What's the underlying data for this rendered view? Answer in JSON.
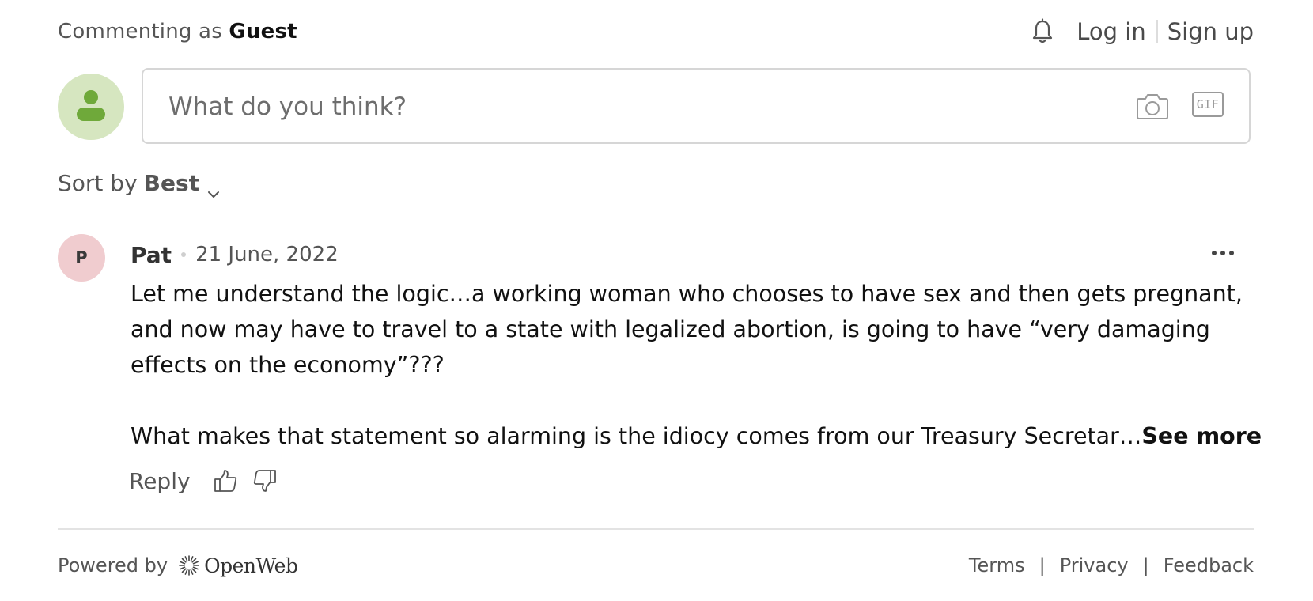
{
  "header": {
    "commenting_prefix": "Commenting as",
    "commenting_user": "Guest",
    "login": "Log in",
    "signup": "Sign up"
  },
  "composer": {
    "placeholder": "What do you think?",
    "gif_label": "GIF",
    "icons": {
      "avatar": "person-icon",
      "camera": "camera-icon",
      "gif": "gif-icon"
    }
  },
  "sort": {
    "prefix": "Sort by",
    "value": "Best"
  },
  "comment": {
    "avatar_initial": "P",
    "author": "Pat",
    "date": "21 June, 2022",
    "lines": [
      "Let me understand the logic…a working woman who chooses to have sex and then gets pregnant,",
      "and now may have to travel to a state with legalized abortion, is going to have “very damaging",
      "effects on the economy”???"
    ],
    "truncated_line": "What makes that statement so alarming is the idiocy comes from our Treasury Secretar…",
    "see_more": "See more",
    "reply": "Reply"
  },
  "footer": {
    "powered_by": "Powered by",
    "brand": "OpenWeb",
    "links": [
      "Terms",
      "Privacy",
      "Feedback"
    ],
    "separator": "|"
  },
  "colors": {
    "guest_avatar_bg": "#d6e6c0",
    "guest_avatar_fg": "#6fa93a",
    "comment_avatar_bg": "#f0cccf",
    "border": "#d6d6d6",
    "divider": "#e3e3e3"
  }
}
